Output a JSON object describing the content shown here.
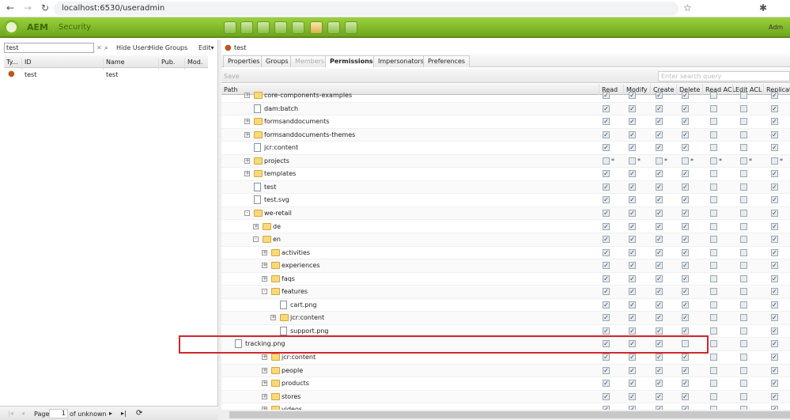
{
  "browser": {
    "url": "localhost:6530/useradmin"
  },
  "header": {
    "brand": "AEM",
    "section": "Security",
    "user": "Adm",
    "toolbar_icons": [
      "sites-icon",
      "globe-icon",
      "assets-icon",
      "campaigns-icon",
      "mail-icon",
      "users-icon",
      "tools-icon",
      "tag-icon"
    ],
    "accent": "#7fb52a"
  },
  "left": {
    "search_value": "test",
    "hide_users": "Hide Users",
    "hide_groups": "Hide Groups",
    "edit": "Edit▾",
    "columns": [
      "Ty...",
      "ID",
      "Name",
      "Pub.",
      "Mod."
    ],
    "rows": [
      {
        "id": "test",
        "name": "test"
      }
    ],
    "pager": {
      "page_label": "Page",
      "page": "1",
      "of": "of unknown"
    }
  },
  "right": {
    "user": "test",
    "tabs": [
      {
        "label": "Properties"
      },
      {
        "label": "Groups"
      },
      {
        "label": "Members",
        "disabled": true
      },
      {
        "label": "Permissions",
        "active": true
      },
      {
        "label": "Impersonators"
      },
      {
        "label": "Preferences"
      }
    ],
    "save": "Save",
    "search_placeholder": "Enter search query",
    "columns": [
      "Path",
      "Read",
      "Modify",
      "Create",
      "Delete",
      "Read ACL",
      "Edit ACL",
      "Replicate"
    ],
    "rows": [
      {
        "name": "core-components-examples",
        "level": 1,
        "exp": "+",
        "type": "folder",
        "perms": [
          1,
          1,
          1,
          1,
          0,
          0,
          1
        ]
      },
      {
        "name": "dam:batch",
        "level": 1,
        "type": "file",
        "perms": [
          1,
          1,
          1,
          1,
          0,
          0,
          1
        ]
      },
      {
        "name": "formsanddocuments",
        "level": 1,
        "exp": "+",
        "type": "folder",
        "perms": [
          1,
          1,
          1,
          1,
          0,
          0,
          1
        ]
      },
      {
        "name": "formsanddocuments-themes",
        "level": 1,
        "exp": "+",
        "type": "folder",
        "perms": [
          1,
          1,
          1,
          1,
          0,
          0,
          1
        ]
      },
      {
        "name": "jcr:content",
        "level": 1,
        "type": "file",
        "perms": [
          1,
          1,
          1,
          1,
          0,
          0,
          1
        ]
      },
      {
        "name": "projects",
        "level": 1,
        "exp": "+",
        "type": "folder",
        "perms": [
          0,
          0,
          0,
          0,
          0,
          0,
          0
        ],
        "mixed": true
      },
      {
        "name": "templates",
        "level": 1,
        "exp": "+",
        "type": "folder",
        "perms": [
          1,
          1,
          1,
          1,
          0,
          0,
          1
        ]
      },
      {
        "name": "test",
        "level": 1,
        "type": "file",
        "perms": [
          1,
          1,
          1,
          1,
          0,
          0,
          1
        ]
      },
      {
        "name": "test.svg",
        "level": 1,
        "type": "file",
        "perms": [
          1,
          1,
          1,
          1,
          0,
          0,
          1
        ]
      },
      {
        "name": "we-retail",
        "level": 1,
        "exp": "-",
        "type": "folder",
        "perms": [
          1,
          1,
          1,
          1,
          0,
          0,
          1
        ]
      },
      {
        "name": "de",
        "level": 2,
        "exp": "+",
        "type": "folder",
        "perms": [
          1,
          1,
          1,
          1,
          0,
          0,
          1
        ]
      },
      {
        "name": "en",
        "level": 2,
        "exp": "-",
        "type": "folder",
        "perms": [
          1,
          1,
          1,
          1,
          0,
          0,
          1
        ]
      },
      {
        "name": "activities",
        "level": 3,
        "exp": "+",
        "type": "folder",
        "perms": [
          1,
          1,
          1,
          1,
          0,
          0,
          1
        ]
      },
      {
        "name": "experiences",
        "level": 3,
        "exp": "+",
        "type": "folder",
        "perms": [
          1,
          1,
          1,
          1,
          0,
          0,
          1
        ]
      },
      {
        "name": "faqs",
        "level": 3,
        "exp": "+",
        "type": "folder",
        "perms": [
          1,
          1,
          1,
          1,
          0,
          0,
          1
        ]
      },
      {
        "name": "features",
        "level": 3,
        "exp": "-",
        "type": "folder",
        "perms": [
          1,
          1,
          1,
          1,
          0,
          0,
          1
        ]
      },
      {
        "name": "cart.png",
        "level": 4,
        "type": "file",
        "perms": [
          1,
          1,
          1,
          1,
          0,
          0,
          1
        ]
      },
      {
        "name": "jcr:content",
        "level": 4,
        "exp": "+",
        "type": "folder",
        "perms": [
          1,
          1,
          1,
          1,
          0,
          0,
          1
        ]
      },
      {
        "name": "support.png",
        "level": 4,
        "type": "file",
        "perms": [
          1,
          1,
          1,
          1,
          0,
          0,
          1
        ]
      },
      {
        "name": "tracking.png",
        "level": 0,
        "type": "file",
        "perms": [
          1,
          1,
          1,
          0,
          0,
          0,
          1
        ],
        "highlighted": true
      },
      {
        "name": "jcr:content",
        "level": 3,
        "exp": "+",
        "type": "folder",
        "perms": [
          1,
          1,
          1,
          1,
          0,
          0,
          1
        ]
      },
      {
        "name": "people",
        "level": 3,
        "exp": "+",
        "type": "folder",
        "perms": [
          1,
          1,
          1,
          1,
          0,
          0,
          1
        ]
      },
      {
        "name": "products",
        "level": 3,
        "exp": "+",
        "type": "folder",
        "perms": [
          1,
          1,
          1,
          1,
          0,
          0,
          1
        ]
      },
      {
        "name": "stores",
        "level": 3,
        "exp": "+",
        "type": "folder",
        "perms": [
          1,
          1,
          1,
          1,
          0,
          0,
          1
        ]
      },
      {
        "name": "videos",
        "level": 3,
        "exp": "+",
        "type": "folder",
        "perms": [
          1,
          1,
          1,
          1,
          0,
          0,
          1
        ]
      }
    ]
  }
}
